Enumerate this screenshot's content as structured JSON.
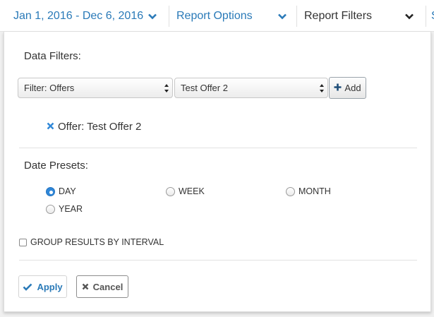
{
  "toolbar": {
    "date_range": "Jan 1, 2016 - Dec 6, 2016",
    "report_options": "Report Options",
    "report_filters": "Report Filters",
    "more": "S"
  },
  "data_filters": {
    "label": "Data Filters:",
    "filter_type_value": "Filter: Offers",
    "filter_value": "Test Offer 2",
    "add_label": "Add",
    "active_filter": "Offer: Test Offer 2"
  },
  "date_presets": {
    "label": "Date Presets:",
    "options": [
      "DAY",
      "WEEK",
      "MONTH",
      "YEAR"
    ],
    "selected": "DAY"
  },
  "group_by_interval": {
    "label": "GROUP RESULTS BY INTERVAL",
    "checked": false
  },
  "actions": {
    "apply_label": "Apply",
    "cancel_label": "Cancel"
  },
  "colors": {
    "accent": "#2a7ab8",
    "radio_selected": "#2f87d8"
  }
}
